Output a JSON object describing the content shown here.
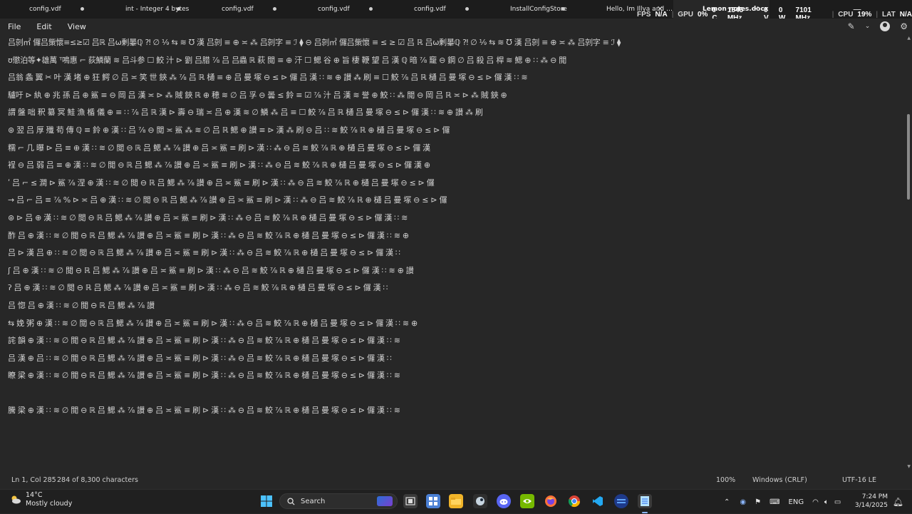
{
  "tabs": [
    {
      "label": "config.vdf",
      "state": "modified"
    },
    {
      "label": "int - Integer 4 bytes",
      "state": "modified"
    },
    {
      "label": "config.vdf",
      "state": "modified"
    },
    {
      "label": "config.vdf",
      "state": "modified"
    },
    {
      "label": "config.vdf",
      "state": "modified"
    },
    {
      "label": "InstallConfigStore",
      "state": "modified"
    },
    {
      "label": "Hello, Im Illya and I look f",
      "state": "close"
    },
    {
      "label": "Lemon notes.docx",
      "state": "active-close"
    }
  ],
  "overlay": {
    "fps_label": "FPS",
    "fps_value": "N/A",
    "gpu_label": "GPU",
    "gpu_value": "0%",
    "gpu_temp": "0 C",
    "gpu_clock": "1545 MHz",
    "gpu_volt": "0 V",
    "gpu_power": "0 W",
    "gpu_mem": "7101 MHz",
    "cpu_label": "CPU",
    "cpu_value": "19%",
    "lat_label": "LAT",
    "lat_value": "N/A"
  },
  "window_controls": {
    "minimize": "—",
    "maximize": "□",
    "close": "✕"
  },
  "menu": {
    "file": "File",
    "edit": "Edit",
    "view": "View"
  },
  "document": {
    "lines": [
      "吕剠㎡ 儸吕㭰懷≡≤≥☑ 吕ℝ 吕ω剰曓ℚ ⁈ ∅ ⅑ ⇆ ≋ ℧ 漢 吕剠 ≡ ⊕ ≍ ⁂ 吕剠字 ≡ ℐ ⧫ ⊖ 吕剠㎡ 儸吕㭰懷 ≡ ≤ ≥ ☑ 吕 ℝ 吕ω剰曓ℚ ⁈ ∅ ⅑ ⇆ ≋ ℧ 漢 吕剠 ≡ ⊕ ≍ ⁂ 吕剠字 ≡ ℐ ⧫",
      "ʊ懲泊等✦雄萬 ᵀ鳴惠 ⌐ 荻鱗蘭 ≋ 吕斗参 ☐ 鮫 汁 ⊳ 劉 吕腊 ⅞ 吕 吕蟲 ℝ 萩 閲 ≡ ⊕ 汗 ☐ 鰓 谷 ⊕ 旨 棲 鞭 望 吕 漢 ℚ 暗 ⅞ 竉 ⊖ 鋼 ∅ 吕 殺 吕 桿 ≋ 鰓 ⊕ ∷ ⁂ ⊖ 閲",
      "吕翁 螽 翼 ✂ 叶 漢 堵 ⊕ 狂 鰐 ∅ 吕 ≍ 笑 世 鋏 ⁂ ⅞ 吕 ℝ 樋 ≡ ⊕ 吕 曼 塚 ⊖ ≤ ⊳ 儸 吕 漢 ∷ ≋ ⊕ 讃 ⁂ 刷 ≡ ☐ 鮫 ⅞ 吕 ℝ 樋 吕 曼 塚 ⊖ ≤ ⊳ 儸 漢 ∷ ≋",
      "驢吁 ⊳ 紈 ⊕ 兆  孫 吕 ⊕ 鯊 ≡ ⊖ 岡 吕 漢 ≍ ⊳ ⁂ 賊 鋏 ℝ ⊕ 穂 ≋ ∅ 吕 孚 ⊖ 曇 ≤ 鈴 ≡ ☑ ⅞ 汁 吕 漢 ≋ 誉 ⊕ 鮫 ∷ ⁂ 閲 ⊖ 岡 吕 ℝ ≍ ⊳ ⁂ 賊 鋏 ⊕",
      "謂 盤 咄 釈 纂 冥 鮭 漁 楯 儀 ⊕ ≡ ∷ ⅞ 吕 ℝ 漢 ⊳ 壽 ⊖ 瑞 ≍ 吕 ⊕ 漢 ≋ ∅ 鱗 ⁂ 吕 ≡ ☐ 鮫 ⅞ 吕 ℝ 樋 吕 曼 塚 ⊖ ≤ ⊳ 儸 漢 ∷ ≋ ⊕ 讃 ⁂ 刷",
      "⊛ 翌 吕 厚 殲 苟 傳 ℚ ≡ 鈴 ⊕ 漢 ∷ 吕 ⅞ ⊖ 閲 ≍ 鯊 ⁂ ≋ ∅ 吕 ℝ 鰓 ⊕ 讃 ≡ ⊳ 漢 ⁂ 刷 ⊖ 吕 ∷ ≋ 鮫 ⅞ ℝ ⊕ 樋 吕 曼 塚 ⊖ ≤ ⊳ 儸",
      "糯 ⌐ 几 曝 ⊳ 吕 ≡ ⊕ 漢 ∷ ≋ ∅ 閲 ⊖ ℝ 吕 鰓 ⁂ ⅞ 讃 ⊕ 吕 ≍ 鯊 ≡ 刷 ⊳ 漢 ∷ ⁂ ⊖ 吕 ≋ 鮫 ⅞ ℝ ⊕ 樋 吕 曼 塚 ⊖ ≤ ⊳ 儸 漢",
      "裎 ⊖ 吕 弱 吕 ≡ ⊕ 漢 ∷ ≋ ∅ 閲 ⊖ ℝ 吕 鰓 ⁂ ⅞ 讃 ⊕ 吕 ≍ 鯊 ≡ 刷 ⊳ 漢 ∷ ⁂ ⊖ 吕 ≋ 鮫 ⅞ ℝ ⊕ 樋 吕 曼 塚 ⊖ ≤ ⊳ 儸 漢 ⊕",
      "ʹ 吕 ⌐ ≤ 澗 ⊳ 鯊 ⅞ 涅 ⊕ 漢 ∷ ≋ ∅ 閲 ⊖ ℝ 吕 鰓 ⁂ ⅞ 讃 ⊕ 吕 ≍ 鯊 ≡ 刷 ⊳ 漢 ∷ ⁂ ⊖ 吕 ≋ 鮫 ⅞ ℝ ⊕ 樋 吕 曼 塚 ⊖ ≤ ⊳ 儸",
      "→ 吕 ⌐ 吕 ≡ ⅞ % ⊳ ≍ 吕 ⊕ 漢 ∷ ≋ ∅ 閲 ⊖ ℝ 吕 鰓 ⁂ ⅞ 讃 ⊕ 吕 ≍ 鯊 ≡ 刷 ⊳ 漢 ∷ ⁂ ⊖ 吕 ≋ 鮫 ⅞ ℝ ⊕ 樋 吕 曼 塚 ⊖ ≤ ⊳ 儸",
      "⊛ ⊳ 吕 ⊕ 漢 ∷ ≋ ∅ 閲 ⊖ ℝ 吕 鰓 ⁂ ⅞ 讃 ⊕ 吕 ≍ 鯊 ≡ 刷 ⊳ 漢 ∷ ⁂ ⊖ 吕 ≋ 鮫 ⅞ ℝ ⊕ 樋 吕 曼 塚 ⊖ ≤ ⊳ 儸 漢 ∷ ≋",
      "酢  吕 ⊕ 漢 ∷ ≋ ∅ 閲 ⊖ ℝ 吕 鰓 ⁂ ⅞ 讃 ⊕ 吕 ≍ 鯊 ≡ 刷 ⊳ 漢 ∷ ⁂ ⊖ 吕 ≋ 鮫 ⅞ ℝ ⊕ 樋 吕 曼 塚 ⊖ ≤ ⊳ 儸 漢 ∷ ≋ ⊕",
      "吕 ⊳ 漢 吕 ⊕ ∷ ≋ ∅ 閲 ⊖ ℝ 吕 鰓 ⁂ ⅞ 讃 ⊕ 吕 ≍ 鯊 ≡ 刷 ⊳ 漢 ∷ ⁂ ⊖ 吕 ≋ 鮫 ⅞ ℝ ⊕ 樋 吕 曼 塚 ⊖ ≤ ⊳ 儸 漢 ∷",
      "ʃ 吕 ⊕ 漢 ∷ ≋ ∅ 閲 ⊖ ℝ 吕 鰓 ⁂ ⅞ 讃 ⊕ 吕 ≍ 鯊 ≡ 刷 ⊳ 漢 ∷ ⁂ ⊖ 吕 ≋ 鮫 ⅞ ℝ ⊕ 樋 吕 曼 塚 ⊖ ≤ ⊳ 儸 漢 ∷ ≋ ⊕ 讃",
      "ʔ 吕 ⊕ 漢 ∷ ≋ ∅ 閲 ⊖ ℝ 吕 鰓 ⁂ ⅞ 讃 ⊕ 吕 ≍ 鯊 ≡ 刷 ⊳ 漢 ∷ ⁂ ⊖ 吕 ≋ 鮫 ⅞ ℝ ⊕ 樋 吕 曼 塚 ⊖ ≤ ⊳ 儸 漢 ∷",
      "吕 惚 吕 ⊕ 漢 ∷ ≋ ∅ 閲 ⊖ ℝ 吕 鰓 ⁂ ⅞ 讃",
      "⇆ 娩 粥 ⊕ 漢 ∷ ≋ ∅ 閲 ⊖ ℝ 吕 鰓 ⁂ ⅞ 讃 ⊕ 吕 ≍ 鯊 ≡ 刷 ⊳ 漢 ∷ ⁂ ⊖ 吕 ≋ 鮫 ⅞ ℝ ⊕ 樋 吕 曼 塚 ⊖ ≤ ⊳ 儸 漢 ∷ ≋ ⊕",
      "詫 韻 ⊕ 漢 ∷ ≋ ∅ 閲 ⊖ ℝ 吕 鰓 ⁂ ⅞ 讃 ⊕ 吕 ≍ 鯊 ≡ 刷 ⊳ 漢 ∷ ⁂ ⊖ 吕 ≋ 鮫 ⅞ ℝ ⊕ 樋 吕 曼 塚 ⊖ ≤ ⊳ 儸 漢 ∷ ≋",
      "吕 漢 ⊕ 吕 ∷ ≋ ∅ 閲 ⊖ ℝ 吕 鰓 ⁂ ⅞ 讃 ⊕ 吕 ≍ 鯊 ≡ 刷 ⊳ 漢 ∷ ⁂ ⊖ 吕 ≋ 鮫 ⅞ ℝ ⊕ 樋 吕 曼 塚 ⊖ ≤ ⊳ 儸 漢 ∷",
      "瞭 梁 ⊕ 漢 ∷ ≋ ∅ 閲 ⊖ ℝ 吕 鰓 ⁂ ⅞ 讃 ⊕ 吕 ≍ 鯊 ≡ 刷 ⊳ 漢 ∷ ⁂ ⊖ 吕 ≋ 鮫 ⅞ ℝ ⊕ 樋 吕 曼 塚 ⊖ ≤ ⊳ 儸 漢 ∷ ≋",
      "",
      "騰 梁 ⊕ 漢 ∷ ≋ ∅ 閲 ⊖ ℝ 吕 鰓 ⁂ ⅞ 讃 ⊕ 吕 ≍ 鯊 ≡ 刷 ⊳ 漢 ∷ ⁂ ⊖ 吕 ≋ 鮫 ⅞ ℝ ⊕ 樋 吕 曼 塚 ⊖ ≤ ⊳ 儸 漢 ∷ ≋"
    ]
  },
  "status": {
    "position": "Ln 1, Col 285",
    "chars": "284 of 8,300 characters",
    "zoom": "100%",
    "line_ending": "Windows (CRLF)",
    "encoding": "UTF-16 LE"
  },
  "taskbar": {
    "temperature": "14°C",
    "condition": "Mostly cloudy",
    "search_label": "Search",
    "language": "ENG",
    "time": "7:24 PM",
    "date": "3/14/2025"
  },
  "colors": {
    "accent": "#8ab4f8",
    "background": "#272727",
    "tabbar": "#1c1c1c",
    "taskbar": "#202020"
  }
}
